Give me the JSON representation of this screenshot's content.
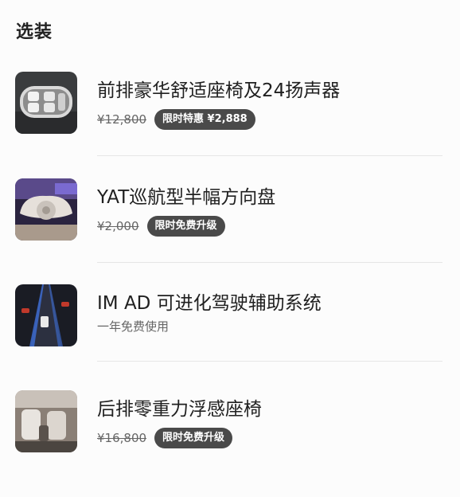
{
  "section": {
    "title": "选装"
  },
  "items": [
    {
      "title": "前排豪华舒适座椅及24扬声器",
      "old_price": "¥12,800",
      "badge": "限时特惠 ¥2,888",
      "thumb_icon": "car-seats-topview-icon"
    },
    {
      "title": "YAT巡航型半幅方向盘",
      "old_price": "¥2,000",
      "badge": "限时免费升级",
      "thumb_icon": "yoke-steering-wheel-icon"
    },
    {
      "title": "IM AD 可进化驾驶辅助系统",
      "subtitle": "一年免费使用",
      "thumb_icon": "driving-assist-road-icon"
    },
    {
      "title": "后排零重力浮感座椅",
      "old_price": "¥16,800",
      "badge": "限时免费升级",
      "thumb_icon": "rear-seats-interior-icon"
    }
  ],
  "colors": {
    "badge_bg": "#4a4a4a",
    "divider": "#e6e6e6",
    "text_primary": "#202020",
    "text_secondary": "#666666"
  }
}
